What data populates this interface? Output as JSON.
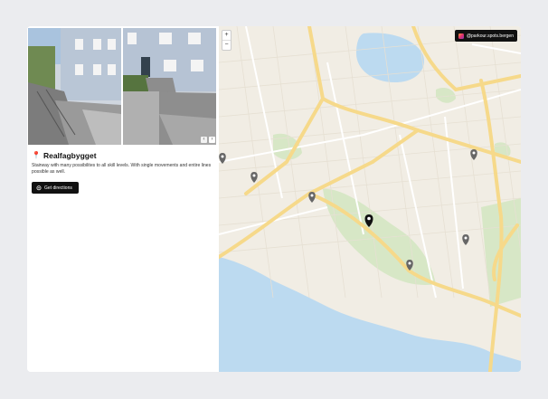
{
  "spot": {
    "title": "Realfagbygget",
    "title_icon": "red-pin",
    "description": "Stairway with many possibilites to all skill levels. With single movements and entire lines possible as well.",
    "directions_label": "Get directions",
    "photos_count": 2
  },
  "map": {
    "zoom_in": "+",
    "zoom_out": "−",
    "instagram_label": "@parkour.spots.bergen",
    "selected_marker": "Realfagbygget"
  },
  "colors": {
    "background": "#ebecef",
    "button": "#111111",
    "map_water": "#bcdaf0",
    "map_park": "#d7e7c6",
    "map_major_road": "#f6d98a"
  }
}
